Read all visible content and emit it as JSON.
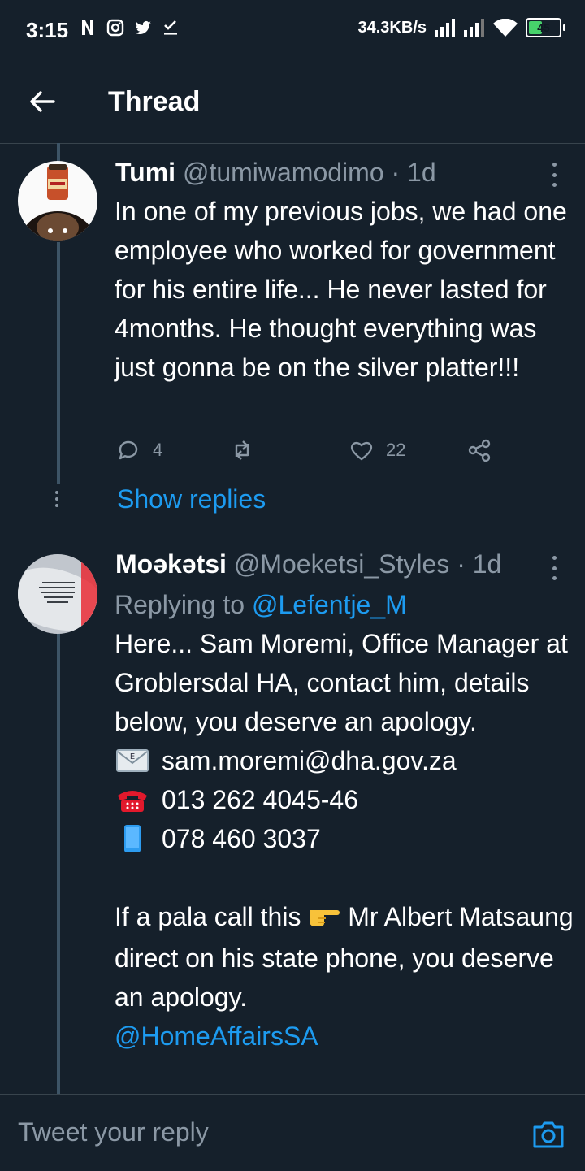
{
  "status_bar": {
    "time": "3:15",
    "net_speed": "34.3KB/s",
    "battery": "45",
    "battery_fraction": 0.45
  },
  "header": {
    "title": "Thread"
  },
  "tweet1": {
    "name": "Tumi",
    "handle": "@tumiwamodimo",
    "meta": " · 1d",
    "body": "In one of my previous jobs, we had one employee who worked for government for his entire life... He never lasted for 4months. He thought everything was just gonna be on the silver platter!!!",
    "reply_count": "4",
    "retweet_count": "",
    "like_count": "22",
    "show_replies": "Show replies"
  },
  "tweet2": {
    "name": "Moəkətsi",
    "handle": "@Moeketsi_Styles",
    "meta": " · 1d",
    "replying_label": "Replying to ",
    "replying_handle": "@Lefentje_M",
    "intro": "Here... Sam Moremi, Office Manager at Groblersdal HA, contact him, details below, you deserve an apology.",
    "email": "sam.moremi@dha.gov.za",
    "phone": "013 262 4045-46",
    "mobile": "078 460 3037",
    "para2_before": "If a pala call this ",
    "para2_after": " Mr Albert Matsaung direct on his state phone, you deserve an apology.",
    "mention": "@HomeAffairsSA"
  },
  "reply_bar": {
    "placeholder": "Tweet your reply"
  },
  "colors": {
    "background": "#15202b",
    "accent": "#1d9bf0",
    "muted": "#8b98a5",
    "divider": "#38444d"
  }
}
